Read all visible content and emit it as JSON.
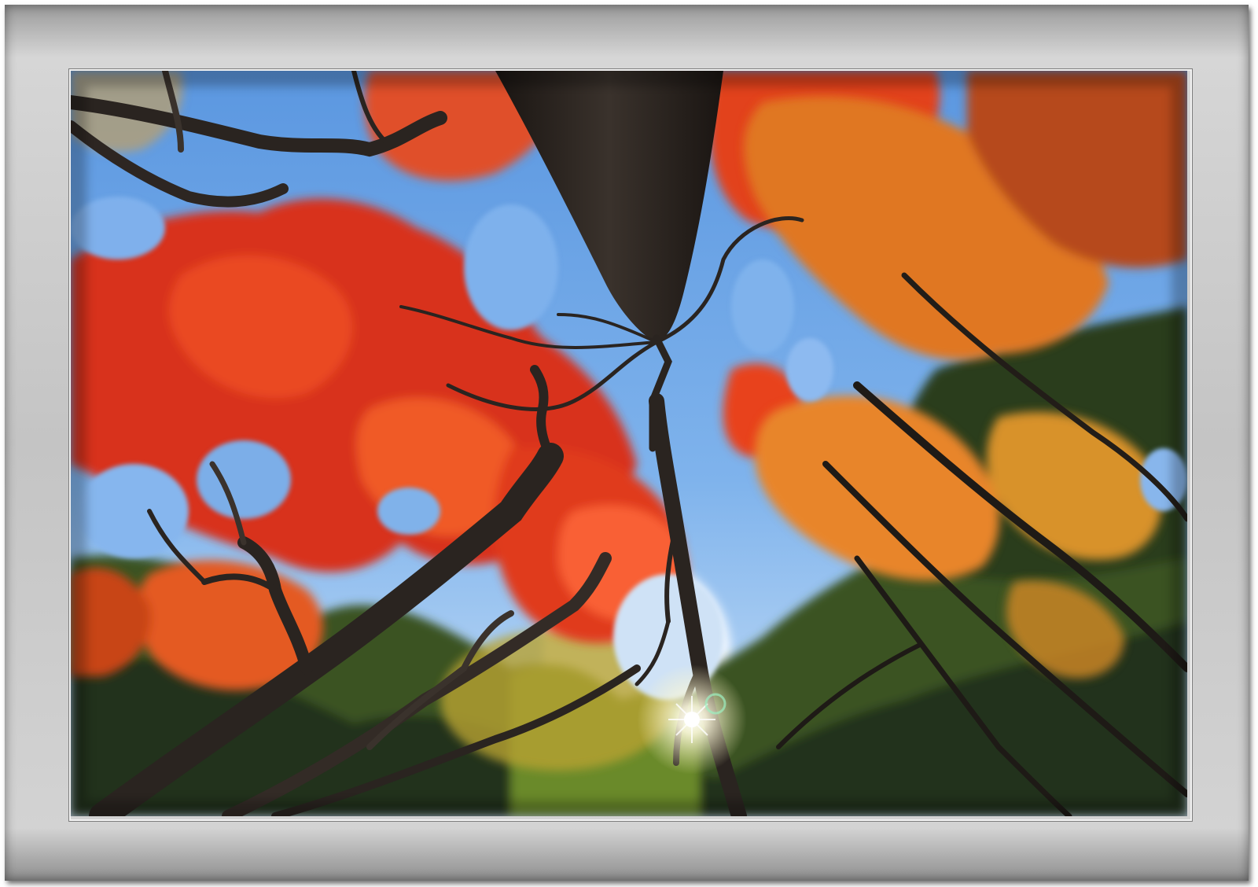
{
  "scene": {
    "subject": "autumn-forest-canopy",
    "colors": {
      "sky": "#6ea6e8",
      "sky_light": "#cfe4f8",
      "foliage_red": "#e23a1c",
      "foliage_orange": "#f07a22",
      "foliage_yellow": "#d9b23a",
      "foliage_green": "#3f5a22",
      "foliage_dark": "#1c2a12",
      "trunk": "#2a2420",
      "sun": "#fffbe8",
      "mat": "#c9c9c9"
    }
  }
}
